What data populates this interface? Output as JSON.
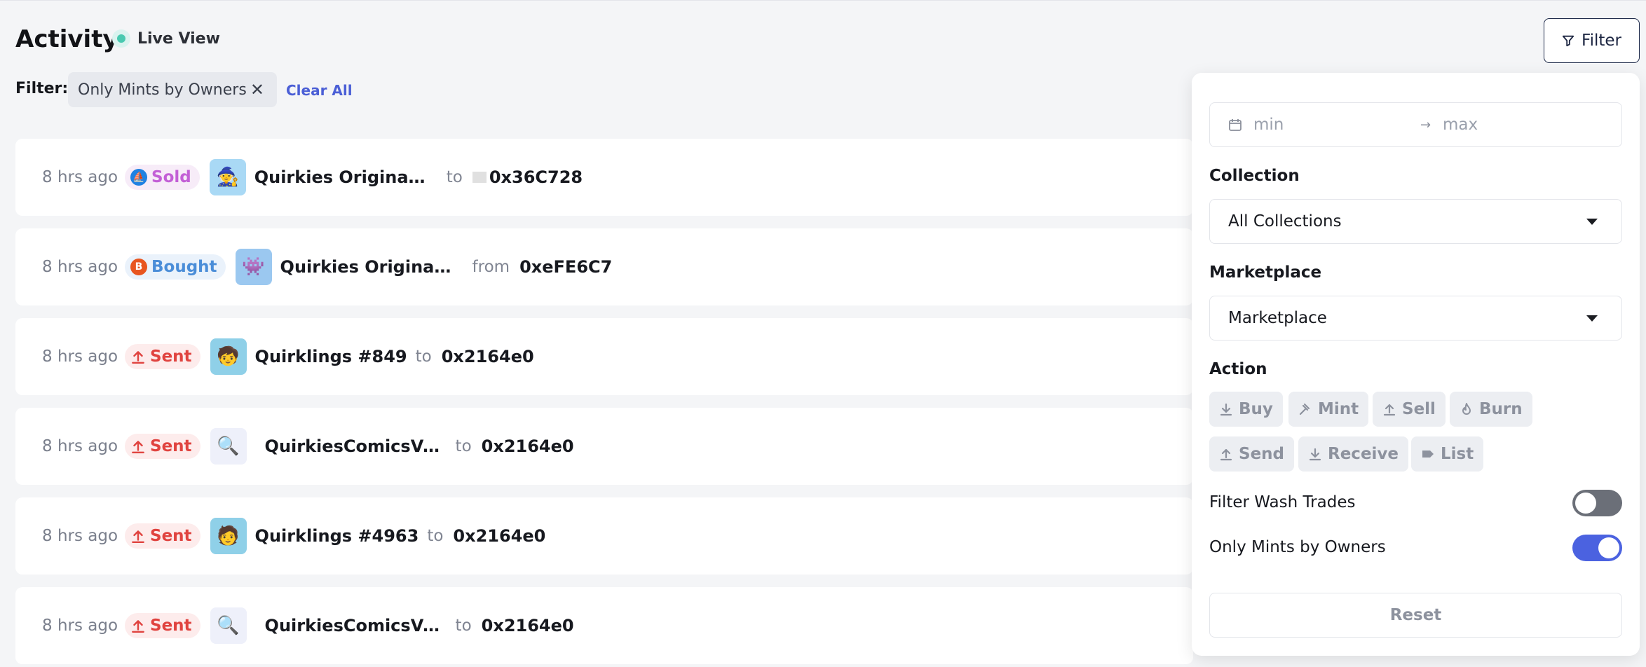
{
  "header": {
    "title": "Activity",
    "live_label": "Live View",
    "filter_button": "Filter"
  },
  "filter_bar": {
    "label": "Filter:",
    "chips": [
      {
        "label": "Only Mints by Owners"
      }
    ],
    "clear_all": "Clear All"
  },
  "activity": [
    {
      "time": "8 hrs ago",
      "action": "Sold",
      "action_icon": "opensea-icon",
      "item": "Quirkies Originals #...",
      "direction": "to",
      "address": "0x36C728"
    },
    {
      "time": "8 hrs ago",
      "action": "Bought",
      "action_icon": "blur-icon",
      "item": "Quirkies Originals #...",
      "direction": "from",
      "address": "0xeFE6C7"
    },
    {
      "time": "8 hrs ago",
      "action": "Sent",
      "action_icon": "upload-icon",
      "item": "Quirklings #849",
      "direction": "to",
      "address": "0x2164e0"
    },
    {
      "time": "8 hrs ago",
      "action": "Sent",
      "action_icon": "upload-icon",
      "item": "QuirkiesComicsVol1 ...",
      "direction": "to",
      "address": "0x2164e0"
    },
    {
      "time": "8 hrs ago",
      "action": "Sent",
      "action_icon": "upload-icon",
      "item": "Quirklings #4963",
      "direction": "to",
      "address": "0x2164e0"
    },
    {
      "time": "8 hrs ago",
      "action": "Sent",
      "action_icon": "upload-icon",
      "item": "QuirkiesComicsVol1 ...",
      "direction": "to",
      "address": "0x2164e0"
    }
  ],
  "panel": {
    "range": {
      "min_placeholder": "min",
      "max_placeholder": "max"
    },
    "collection": {
      "label": "Collection",
      "value": "All Collections"
    },
    "marketplace": {
      "label": "Marketplace",
      "value": "Marketplace"
    },
    "action": {
      "label": "Action",
      "buttons": [
        {
          "label": "Buy",
          "icon": "download-icon"
        },
        {
          "label": "Mint",
          "icon": "hammer-icon"
        },
        {
          "label": "Sell",
          "icon": "upload-icon"
        },
        {
          "label": "Burn",
          "icon": "flame-icon"
        },
        {
          "label": "Send",
          "icon": "upload-icon"
        },
        {
          "label": "Receive",
          "icon": "download-icon"
        },
        {
          "label": "List",
          "icon": "tag-icon"
        }
      ]
    },
    "toggles": [
      {
        "label": "Filter Wash Trades",
        "on": false
      },
      {
        "label": "Only Mints by Owners",
        "on": true
      }
    ],
    "reset": "Reset"
  },
  "colors": {
    "accent": "#4b62e0",
    "sold": "#c35fd6",
    "bought": "#4a8dd8",
    "sent": "#e0433f",
    "live": "#48c9b0"
  }
}
